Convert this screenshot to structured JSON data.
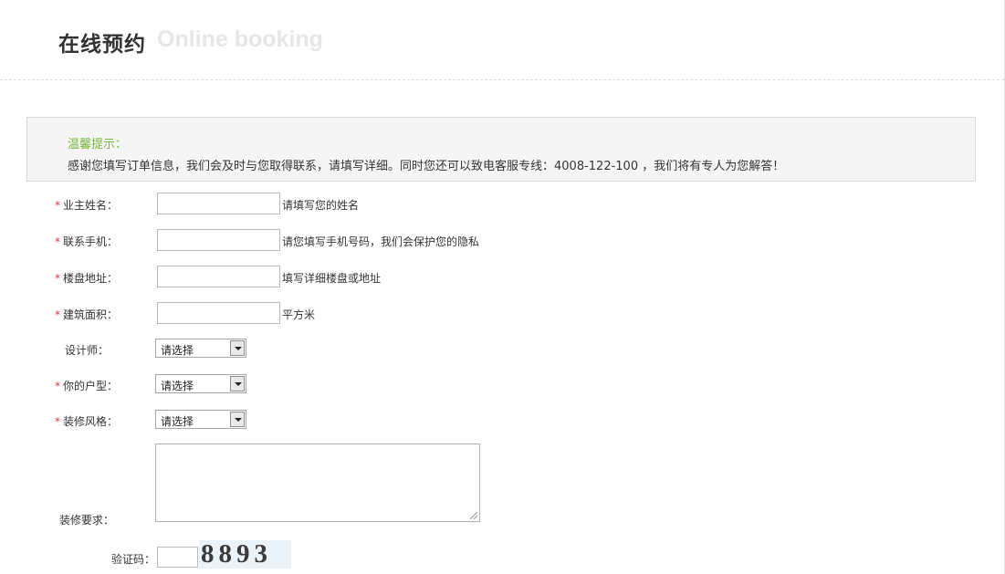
{
  "header": {
    "title_cn": "在线预约",
    "title_en": "Online booking"
  },
  "notice": {
    "title": "温馨提示：",
    "text": "感谢您填写订单信息，我们会及时与您取得联系，请填写详细。同时您还可以致电客服专线：4008-122-100 ，我们将有专人为您解答！"
  },
  "form": {
    "required_mark": "*",
    "owner_name": {
      "label": "业主姓名：",
      "value": "",
      "hint": "请填写您的姓名"
    },
    "phone": {
      "label": "联系手机：",
      "value": "",
      "hint": "请您填写手机号码，我们会保护您的隐私"
    },
    "address": {
      "label": "楼盘地址：",
      "value": "",
      "hint": "填写详细楼盘或地址"
    },
    "area": {
      "label": "建筑面积：",
      "value": "",
      "hint": "平方米"
    },
    "designer": {
      "label": "设计师：",
      "selected": "请选择"
    },
    "house_type": {
      "label": "你的户型：",
      "selected": "请选择"
    },
    "style": {
      "label": "装修风格：",
      "selected": "请选择"
    },
    "requirements": {
      "label": "装修要求：",
      "value": ""
    },
    "captcha": {
      "label": "验证码：",
      "value": "",
      "image_text": "8893"
    }
  }
}
